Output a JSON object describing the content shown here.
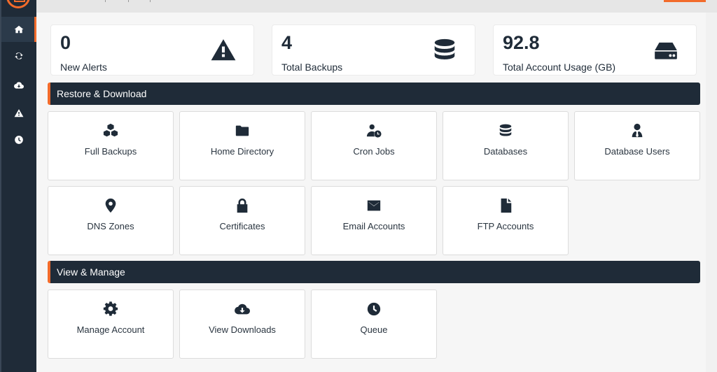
{
  "sidebar": {
    "items": [
      {
        "name": "home",
        "icon": "home-icon",
        "active": true
      },
      {
        "name": "sync",
        "icon": "sync-icon",
        "active": false
      },
      {
        "name": "downloads",
        "icon": "cloud-download-icon",
        "active": false
      },
      {
        "name": "alerts",
        "icon": "warning-icon",
        "active": false
      },
      {
        "name": "queue",
        "icon": "clock-icon",
        "active": false
      }
    ]
  },
  "stats": [
    {
      "value": "0",
      "label": "New Alerts",
      "icon": "warning-icon"
    },
    {
      "value": "4",
      "label": "Total Backups",
      "icon": "database-icon"
    },
    {
      "value": "92.8",
      "label": "Total Account Usage (GB)",
      "icon": "hdd-icon"
    }
  ],
  "sections": [
    {
      "title": "Restore & Download",
      "tiles": [
        {
          "label": "Full Backups",
          "icon": "cubes-icon"
        },
        {
          "label": "Home Directory",
          "icon": "folder-icon"
        },
        {
          "label": "Cron Jobs",
          "icon": "user-clock-icon"
        },
        {
          "label": "Databases",
          "icon": "database-icon"
        },
        {
          "label": "Database Users",
          "icon": "user-tie-icon"
        },
        {
          "label": "DNS Zones",
          "icon": "map-marker-icon"
        },
        {
          "label": "Certificates",
          "icon": "lock-icon"
        },
        {
          "label": "Email Accounts",
          "icon": "envelope-icon"
        },
        {
          "label": "FTP Accounts",
          "icon": "file-icon"
        }
      ]
    },
    {
      "title": "View & Manage",
      "tiles": [
        {
          "label": "Manage Account",
          "icon": "cog-icon"
        },
        {
          "label": "View Downloads",
          "icon": "cloud-download-icon"
        },
        {
          "label": "Queue",
          "icon": "clock-icon"
        }
      ]
    }
  ],
  "colors": {
    "sidebar_bg": "#1f2b38",
    "accent": "#f26b2b",
    "text_dark": "#1f2b38",
    "page_bg": "#f6f6f6"
  }
}
